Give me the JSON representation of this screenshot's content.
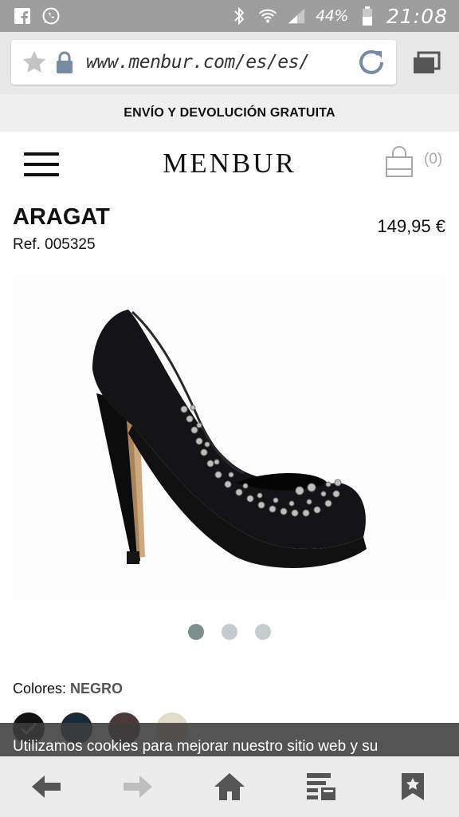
{
  "status_bar": {
    "left_icons": [
      "facebook-icon",
      "whatsapp-icon"
    ],
    "right_icons": [
      "bluetooth-icon",
      "wifi-icon",
      "signal-icon",
      "battery-icon"
    ],
    "battery": "44%",
    "time": "21:08"
  },
  "browser": {
    "url": "www.menbur.com/es/es/",
    "icons": [
      "star-icon",
      "lock-icon",
      "reload-icon",
      "tabs-icon"
    ]
  },
  "promo": {
    "text": "ENVÍO Y DEVOLUCIÓN GRATUITA"
  },
  "header": {
    "logo": "MENBUR",
    "cart_count": "(0)"
  },
  "product": {
    "name": "ARAGAT",
    "ref": "Ref. 005325",
    "price": "149,95 €",
    "image_count": 3,
    "active_image": 1
  },
  "colors": {
    "label": "Colores:",
    "selected": "NEGRO",
    "swatches": [
      {
        "name": "negro",
        "hex": "#111111",
        "selected": true
      },
      {
        "name": "azul",
        "hex": "#1b2a38",
        "selected": false
      },
      {
        "name": "marron",
        "hex": "#4a3a38",
        "selected": false
      },
      {
        "name": "beige",
        "hex": "#e0dccb",
        "selected": false
      }
    ]
  },
  "cookie_banner": {
    "text": "Utilizamos cookies para mejorar nuestro sitio web y su"
  },
  "toolbar": {
    "icons": [
      "back-arrow-icon",
      "forward-arrow-icon",
      "home-icon",
      "reading-list-icon",
      "bookmark-icon"
    ]
  },
  "theme": {
    "status_bar": "#9e9e9e",
    "dot_active": "#7b8f8d",
    "dot_inactive": "#c4cdcc",
    "toolbar_icon": "#555555"
  }
}
